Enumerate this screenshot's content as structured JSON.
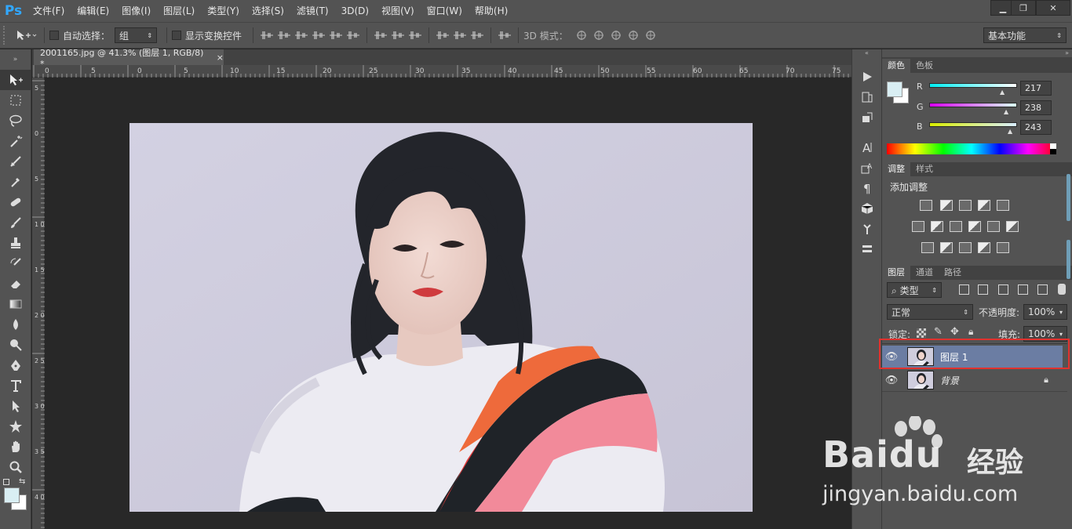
{
  "app": {
    "logo": "Ps"
  },
  "menu": [
    "文件(F)",
    "编辑(E)",
    "图像(I)",
    "图层(L)",
    "类型(Y)",
    "选择(S)",
    "滤镜(T)",
    "3D(D)",
    "视图(V)",
    "窗口(W)",
    "帮助(H)"
  ],
  "window_controls": {
    "minimize": "▁",
    "restore": "❐",
    "close": "✕"
  },
  "options": {
    "auto_select_label": "自动选择：",
    "auto_select_value": "组",
    "show_transform_label": "显示变换控件",
    "mode_3d_label": "3D 模式：",
    "workspace": "基本功能"
  },
  "document": {
    "tab_title": "2001165.jpg @ 41.3% (图层 1, RGB/8) *",
    "close": "×"
  },
  "ruler_h_labels": [
    "0",
    "5",
    "0",
    "5",
    "10",
    "15",
    "20",
    "25",
    "30",
    "35",
    "40",
    "45",
    "50",
    "55",
    "60",
    "65",
    "70",
    "75"
  ],
  "ruler_v_labels": [
    "5",
    "0",
    "5",
    "1 0",
    "1 5",
    "2 0",
    "2 5",
    "3 0",
    "3 5",
    "4 0"
  ],
  "color_panel": {
    "tabs": [
      "颜色",
      "色板"
    ],
    "r_label": "R",
    "g_label": "G",
    "b_label": "B",
    "r": "217",
    "g": "238",
    "b": "243",
    "foreground": "#d9eef3"
  },
  "adjust_panel": {
    "tabs": [
      "调整",
      "样式"
    ],
    "title": "添加调整"
  },
  "layers_panel": {
    "tabs": [
      "图层",
      "通道",
      "路径"
    ],
    "filter_kind": "类型",
    "blend_mode": "正常",
    "opacity_label": "不透明度:",
    "opacity": "100%",
    "lock_label": "锁定:",
    "fill_label": "填充:",
    "fill": "100%",
    "layers": [
      {
        "name": "图层 1",
        "selected": true
      },
      {
        "name": "背景",
        "selected": false,
        "locked": true
      }
    ]
  },
  "watermark": {
    "brand": "Baidu",
    "brand_suffix": "经验",
    "url": "jingyan.baidu.com"
  }
}
